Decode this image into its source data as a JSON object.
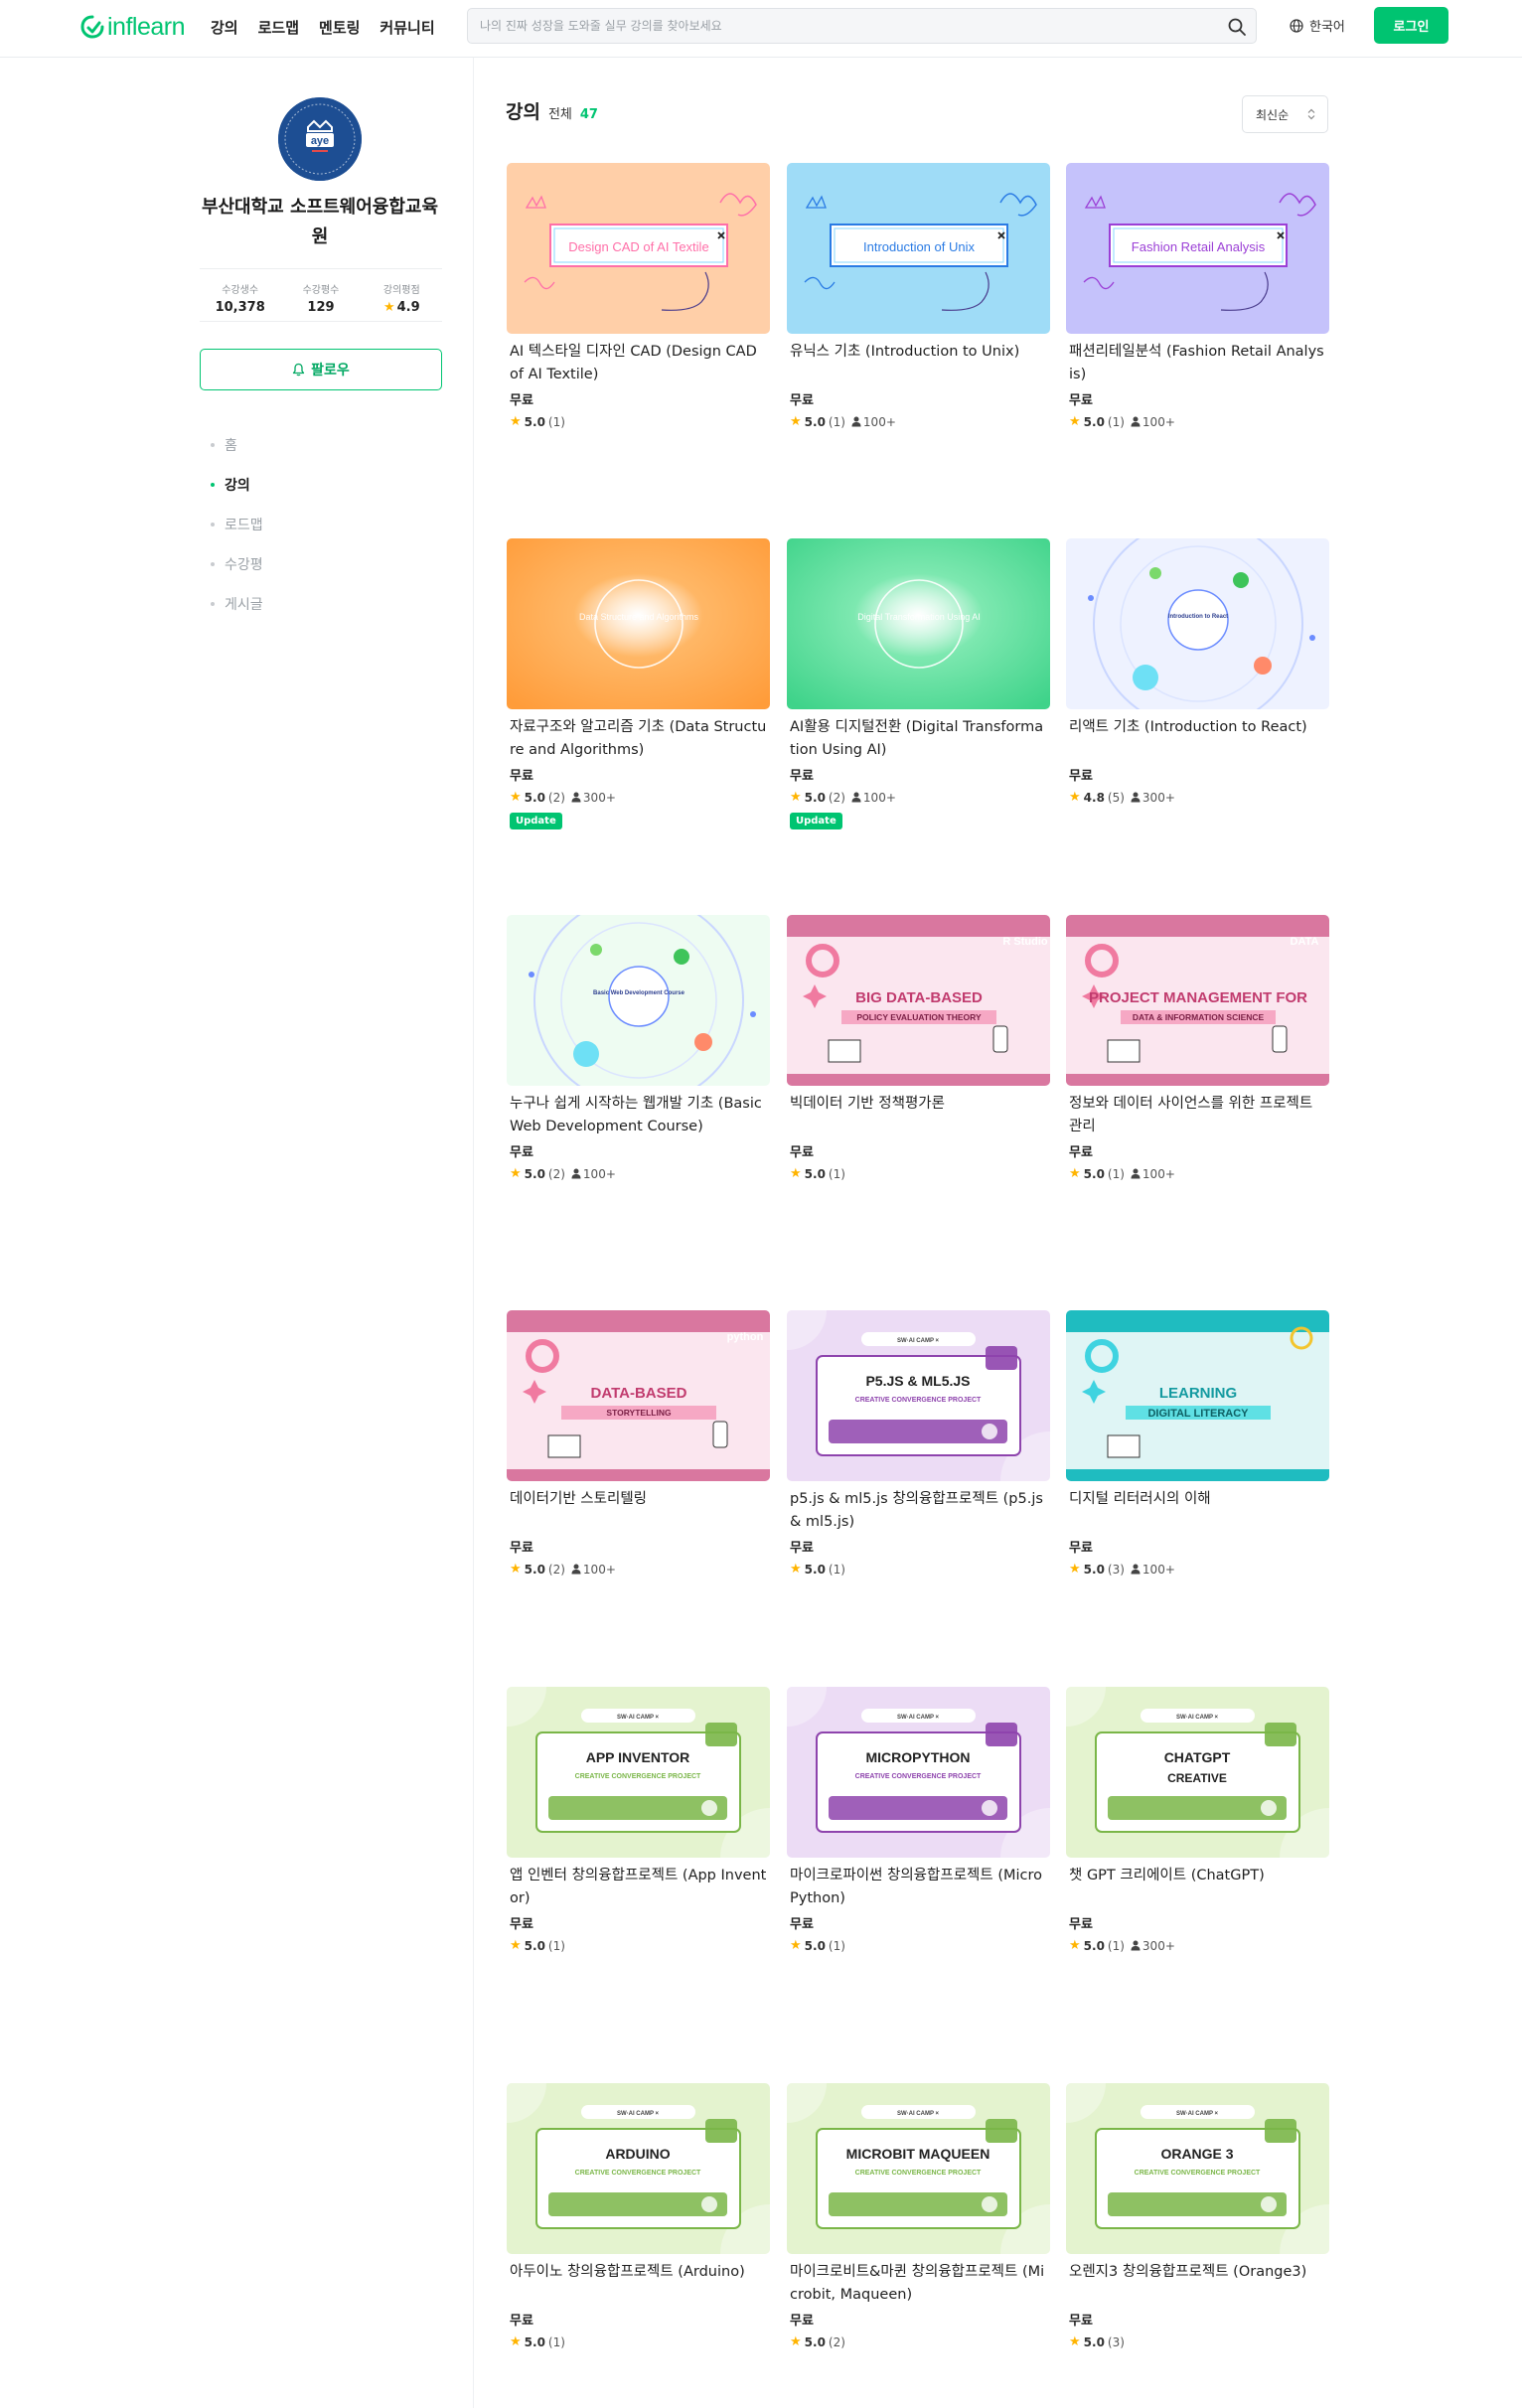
{
  "header": {
    "logo_text": "inflearn",
    "nav": [
      "강의",
      "로드맵",
      "멘토링",
      "커뮤니티"
    ],
    "search_placeholder": "나의 진짜 성장을 도와줄 실무 강의를 찾아보세요",
    "language": "한국어",
    "login": "로그인",
    "brand_color": "#00c471"
  },
  "sidebar": {
    "avatar_text": "aye",
    "name": "부산대학교 소프트웨어융합교육원",
    "stats": [
      {
        "label": "수강생수",
        "value": "10,378"
      },
      {
        "label": "수강평수",
        "value": "129"
      },
      {
        "label": "강의평점",
        "value": "4.9"
      }
    ],
    "follow": "팔로우",
    "menu": [
      {
        "label": "홈",
        "active": false
      },
      {
        "label": "강의",
        "active": true
      },
      {
        "label": "로드맵",
        "active": false
      },
      {
        "label": "수강평",
        "active": false
      },
      {
        "label": "게시글",
        "active": false
      }
    ]
  },
  "main": {
    "title": "강의",
    "total_label": "전체",
    "total_count": "47",
    "sort": "최신순",
    "courses": [
      {
        "title": "AI 텍스타일 디자인 CAD (Design CAD of AI Textile)",
        "price": "무료",
        "rating": "5.0",
        "reviews": "(1)",
        "students": "",
        "badge": "",
        "thumb": {
          "style": "sketch",
          "bg": "#ffcfa8",
          "text": "Design CAD of AI Textile",
          "accent": "#ff6fa8"
        }
      },
      {
        "title": "유닉스 기초 (Introduction to Unix)",
        "price": "무료",
        "rating": "5.0",
        "reviews": "(1)",
        "students": "100+",
        "badge": "",
        "thumb": {
          "style": "sketch",
          "bg": "#9fdcf7",
          "text": "Introduction of Unix",
          "accent": "#2a7be4"
        }
      },
      {
        "title": "패션리테일분석 (Fashion Retail Analysis)",
        "price": "무료",
        "rating": "5.0",
        "reviews": "(1)",
        "students": "100+",
        "badge": "",
        "thumb": {
          "style": "sketch",
          "bg": "#c5c2fb",
          "text": "Fashion Retail Analysis",
          "accent": "#9b3fd6"
        }
      },
      {
        "title": "자료구조와 알고리즘 기초 (Data Structure and Algorithms)",
        "price": "무료",
        "rating": "5.0",
        "reviews": "(2)",
        "students": "300+",
        "badge": "Update",
        "thumb": {
          "style": "gradient",
          "bg": "#ffb766",
          "bg2": "#ff9c3a",
          "text": "Data Structure and Algorithms"
        }
      },
      {
        "title": "AI활용 디지털전환 (Digital Transformation Using AI)",
        "price": "무료",
        "rating": "5.0",
        "reviews": "(2)",
        "students": "100+",
        "badge": "Update",
        "thumb": {
          "style": "gradient",
          "bg": "#7de8b0",
          "bg2": "#3fd38a",
          "text": "Digital Transformation Using AI"
        }
      },
      {
        "title": "리액트 기초 (Introduction to React)",
        "price": "무료",
        "rating": "4.8",
        "reviews": "(5)",
        "students": "300+",
        "badge": "",
        "thumb": {
          "style": "circles",
          "bg": "#eef2ff",
          "text": "Introduction to React"
        }
      },
      {
        "title": "누구나 쉽게 시작하는 웹개발 기초 (Basic Web Development Course)",
        "price": "무료",
        "rating": "5.0",
        "reviews": "(2)",
        "students": "100+",
        "badge": "",
        "thumb": {
          "style": "circles",
          "bg": "#eefcf2",
          "text": "Basic Web Development Course"
        }
      },
      {
        "title": "빅데이터 기반 정책평가론",
        "price": "무료",
        "rating": "5.0",
        "reviews": "(1)",
        "students": "",
        "badge": "",
        "thumb": {
          "style": "pinkband",
          "bg": "#fbe6ef",
          "band": "#d9779f",
          "text": "BIG DATA-BASED",
          "sub": "POLICY EVALUATION THEORY",
          "corner": "R Studio"
        }
      },
      {
        "title": "정보와 데이터 사이언스를 위한 프로젝트 관리",
        "price": "무료",
        "rating": "5.0",
        "reviews": "(1)",
        "students": "100+",
        "badge": "",
        "thumb": {
          "style": "pinkband",
          "bg": "#fbe6ef",
          "band": "#d9779f",
          "text": "PROJECT MANAGEMENT FOR",
          "sub": "DATA & INFORMATION SCIENCE",
          "corner": "DATA"
        }
      },
      {
        "title": "데이터기반 스토리텔링",
        "price": "무료",
        "rating": "5.0",
        "reviews": "(2)",
        "students": "100+",
        "badge": "",
        "thumb": {
          "style": "pinkband",
          "bg": "#fbe6ef",
          "band": "#d9779f",
          "text": "DATA-BASED",
          "sub": "STORYTELLING",
          "corner": "python"
        }
      },
      {
        "title": "p5.js & ml5.js 창의융합프로젝트 (p5.js & ml5.js)",
        "price": "무료",
        "rating": "5.0",
        "reviews": "(1)",
        "students": "",
        "badge": "",
        "thumb": {
          "style": "camp",
          "bg": "#ecdcf5",
          "card": "#ffffff",
          "head": "P5.JS & ML5.JS",
          "head2": "",
          "sub": "CREATIVE CONVERGENCE PROJECT",
          "accent": "#8e44ad"
        }
      },
      {
        "title": "디지털 리터러시의 이해",
        "price": "무료",
        "rating": "5.0",
        "reviews": "(3)",
        "students": "100+",
        "badge": "",
        "thumb": {
          "style": "tealband",
          "bg": "#dff5f5",
          "band": "#1fbcc0",
          "text": "LEARNING",
          "sub": "DIGITAL LITERACY"
        }
      },
      {
        "title": "앱 인벤터 창의융합프로젝트 (App Inventor)",
        "price": "무료",
        "rating": "5.0",
        "reviews": "(1)",
        "students": "",
        "badge": "",
        "thumb": {
          "style": "camp",
          "bg": "#e4f3cf",
          "card": "#ffffff",
          "head": "APP INVENTOR",
          "head2": "",
          "sub": "CREATIVE CONVERGENCE PROJECT",
          "accent": "#7ab648"
        }
      },
      {
        "title": "마이크로파이썬 창의융합프로젝트 (MicroPython)",
        "price": "무료",
        "rating": "5.0",
        "reviews": "(1)",
        "students": "",
        "badge": "",
        "thumb": {
          "style": "camp",
          "bg": "#ecdcf5",
          "card": "#ffffff",
          "head": "MICROPYTHON",
          "head2": "",
          "sub": "CREATIVE CONVERGENCE PROJECT",
          "accent": "#8e44ad"
        }
      },
      {
        "title": "챗 GPT 크리에이트 (ChatGPT)",
        "price": "무료",
        "rating": "5.0",
        "reviews": "(1)",
        "students": "300+",
        "badge": "",
        "thumb": {
          "style": "camp",
          "bg": "#e4f3cf",
          "card": "#ffffff",
          "head": "CHATGPT",
          "head2": "CREATIVE",
          "sub": "",
          "accent": "#7ab648"
        }
      },
      {
        "title": "아두이노 창의융합프로젝트 (Arduino)",
        "price": "무료",
        "rating": "5.0",
        "reviews": "(1)",
        "students": "",
        "badge": "",
        "thumb": {
          "style": "camp",
          "bg": "#e4f3cf",
          "card": "#ffffff",
          "head": "ARDUINO",
          "head2": "",
          "sub": "CREATIVE CONVERGENCE PROJECT",
          "accent": "#7ab648"
        }
      },
      {
        "title": "마이크로비트&마퀸 창의융합프로젝트 (Microbit, Maqueen)",
        "price": "무료",
        "rating": "5.0",
        "reviews": "(2)",
        "students": "",
        "badge": "",
        "thumb": {
          "style": "camp",
          "bg": "#e4f3cf",
          "card": "#ffffff",
          "head": "MICROBIT MAQUEEN",
          "head2": "",
          "sub": "CREATIVE CONVERGENCE PROJECT",
          "accent": "#7ab648"
        }
      },
      {
        "title": "오렌지3 창의융합프로젝트 (Orange3)",
        "price": "무료",
        "rating": "5.0",
        "reviews": "(3)",
        "students": "",
        "badge": "",
        "thumb": {
          "style": "camp",
          "bg": "#e4f3cf",
          "card": "#ffffff",
          "head": "ORANGE 3",
          "head2": "",
          "sub": "CREATIVE CONVERGENCE PROJECT",
          "accent": "#7ab648"
        }
      }
    ]
  }
}
